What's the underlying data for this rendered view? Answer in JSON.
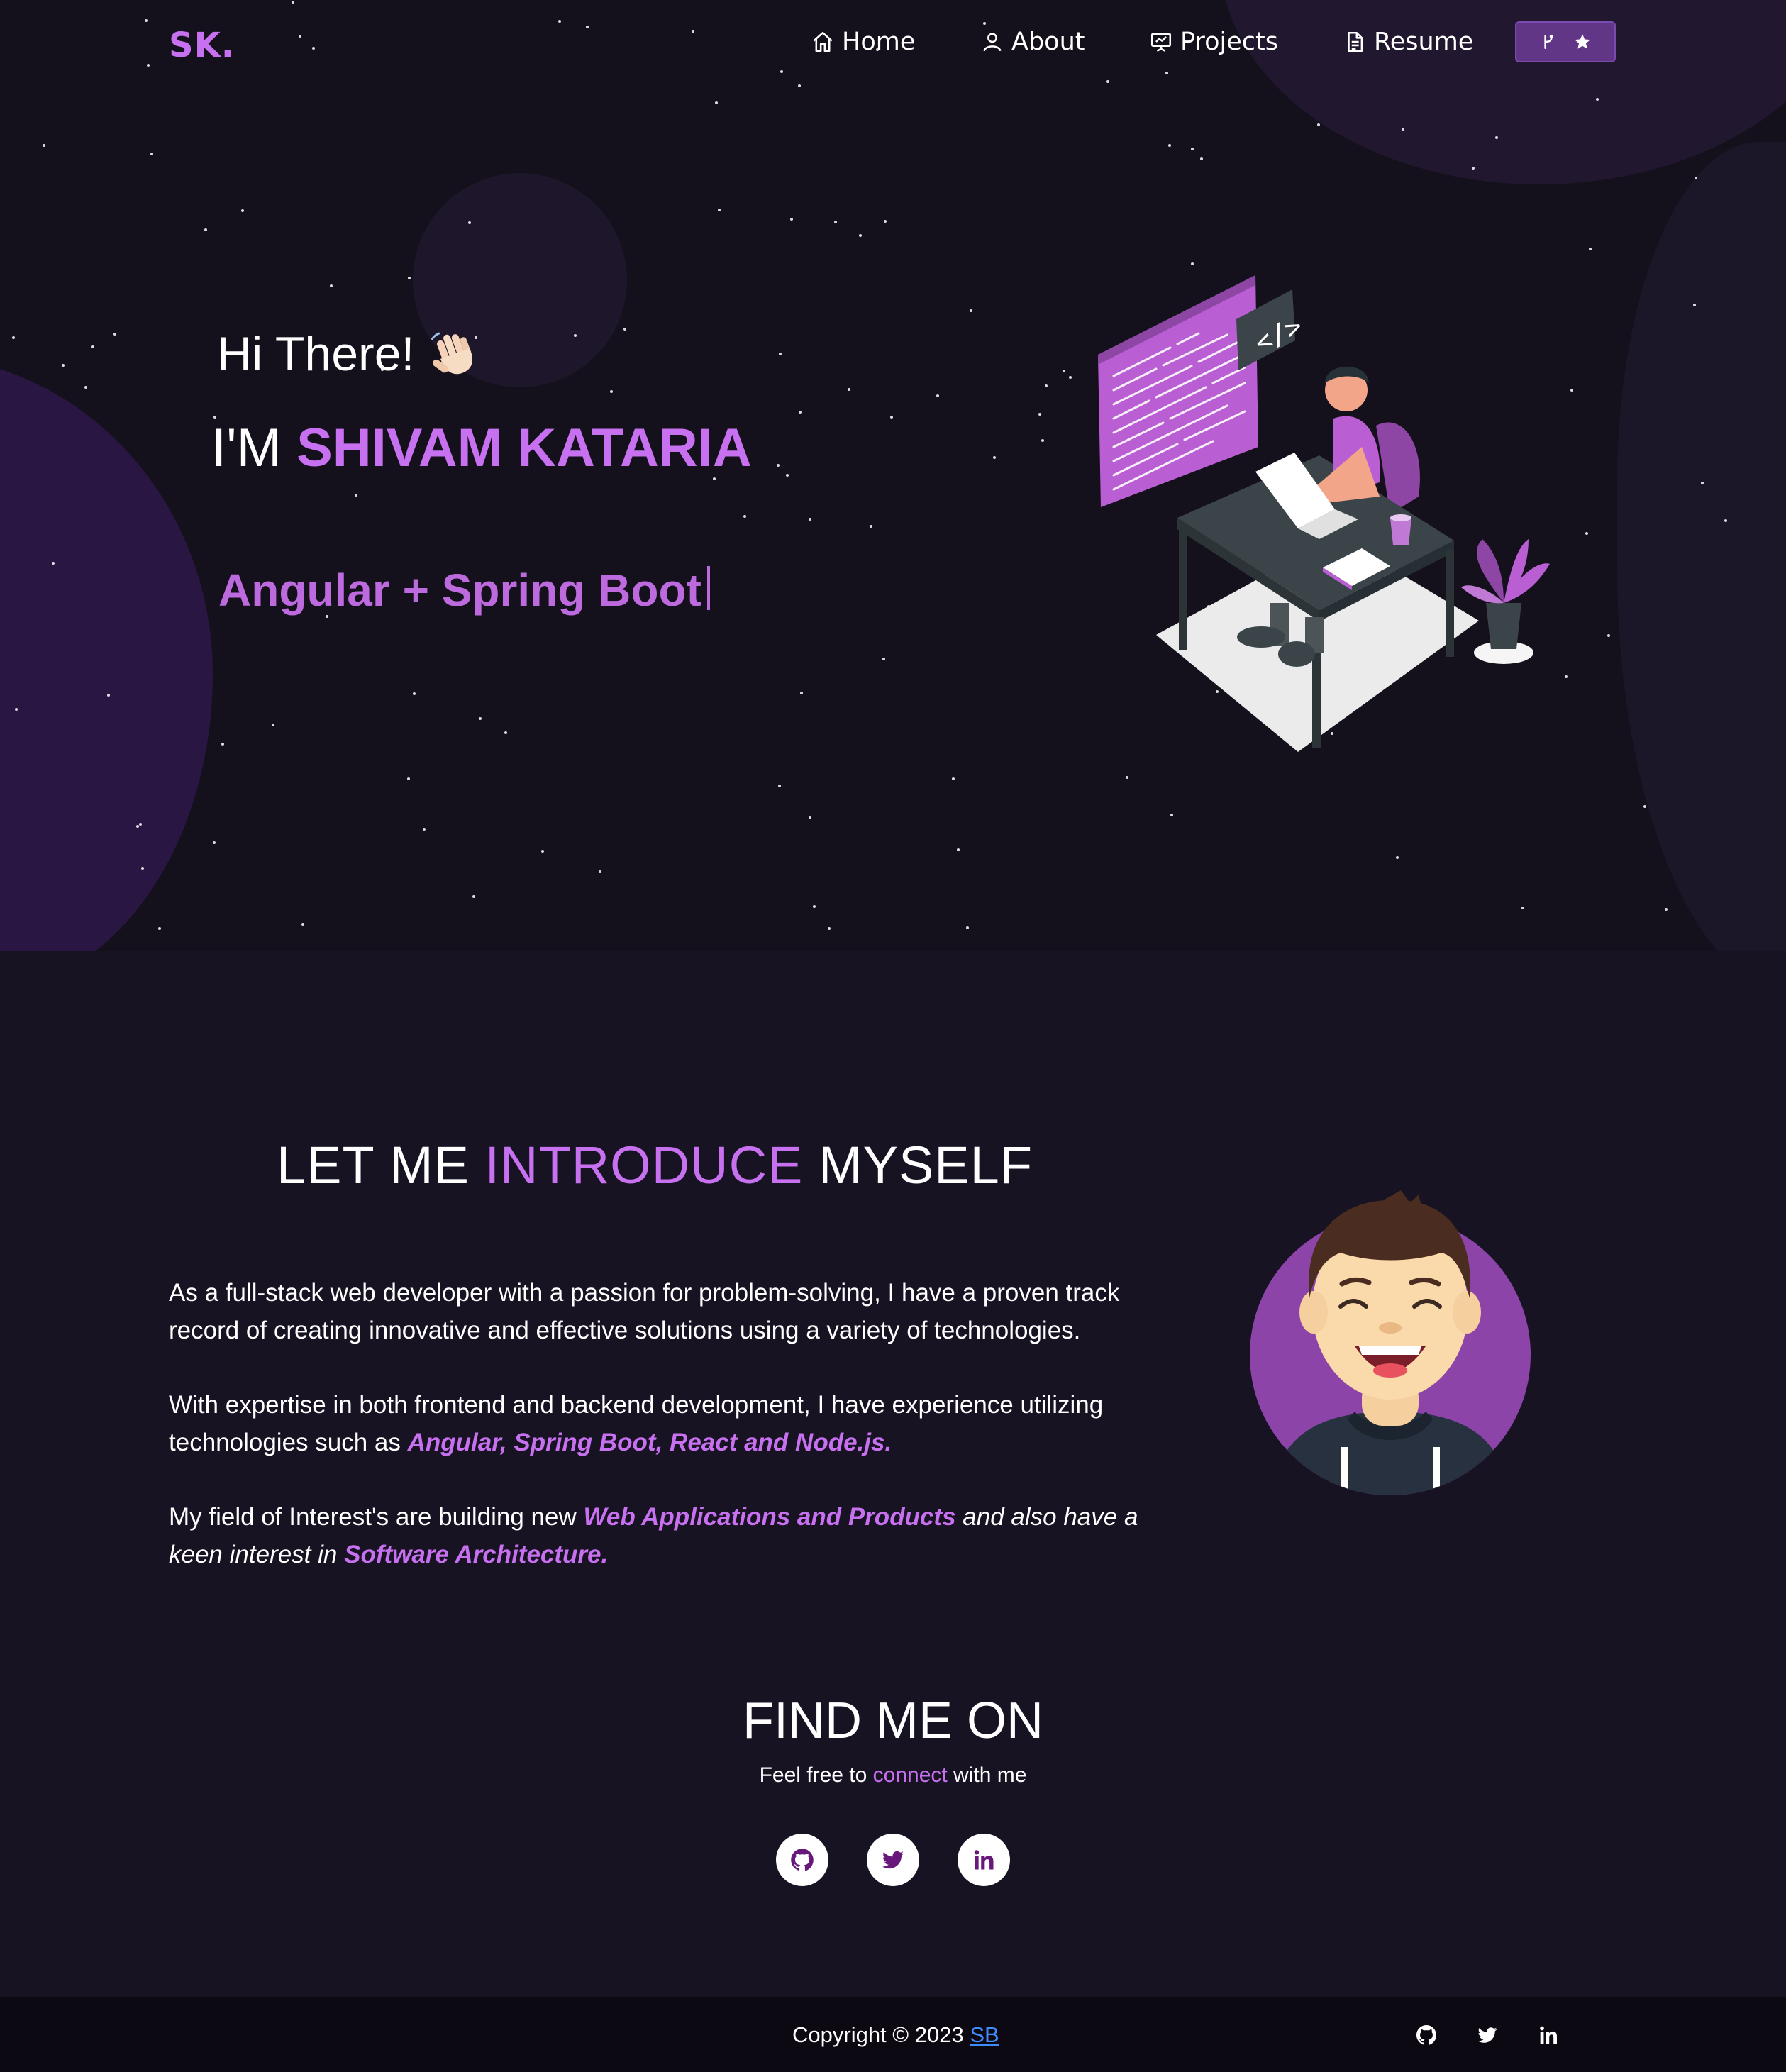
{
  "nav": {
    "logo": "SK.",
    "items": [
      {
        "label": "Home",
        "icon": "home-icon"
      },
      {
        "label": "About",
        "icon": "user-icon"
      },
      {
        "label": "Projects",
        "icon": "presentation-icon"
      },
      {
        "label": "Resume",
        "icon": "document-icon"
      }
    ],
    "github_button_icons": [
      "git-fork-icon",
      "star-icon"
    ]
  },
  "hero": {
    "greeting": "Hi There!",
    "wave_icon": "waving-hand-icon",
    "im_prefix": "I'M ",
    "name": "SHIVAM KATARIA",
    "typed_text": "Angular + Spring Boot",
    "illustration": "developer-at-desk-illustration"
  },
  "about": {
    "title_part1": "LET ME ",
    "title_highlight": "INTRODUCE",
    "title_part2": " MYSELF",
    "para1": "As a full-stack web developer with a passion for problem-solving, I have a proven track record of creating innovative and effective solutions using a variety of technologies.",
    "para2_prefix": "With expertise in both frontend and backend development, I have experience utilizing technologies such as ",
    "para2_highlight": "Angular, Spring Boot, React and Node.js.",
    "para3_prefix": "My field of Interest's are building new  ",
    "para3_highlight1": "Web Applications and Products",
    "para3_mid": " and also have a keen interest in ",
    "para3_highlight2": "Software Architecture.",
    "avatar": "avatar-illustration"
  },
  "find": {
    "title": "FIND ME ON",
    "sub_prefix": "Feel free to ",
    "sub_highlight": "connect",
    "sub_suffix": " with me",
    "icons": [
      "github-icon",
      "twitter-icon",
      "linkedin-icon"
    ]
  },
  "footer": {
    "copy_prefix": "Copyright © 2023 ",
    "copy_link": "SB",
    "icons": [
      "github-icon",
      "twitter-icon",
      "linkedin-icon"
    ]
  },
  "colors": {
    "accent": "#c770f0",
    "background": "#171323",
    "footer": "#0c0913",
    "link": "#3f8cff"
  }
}
